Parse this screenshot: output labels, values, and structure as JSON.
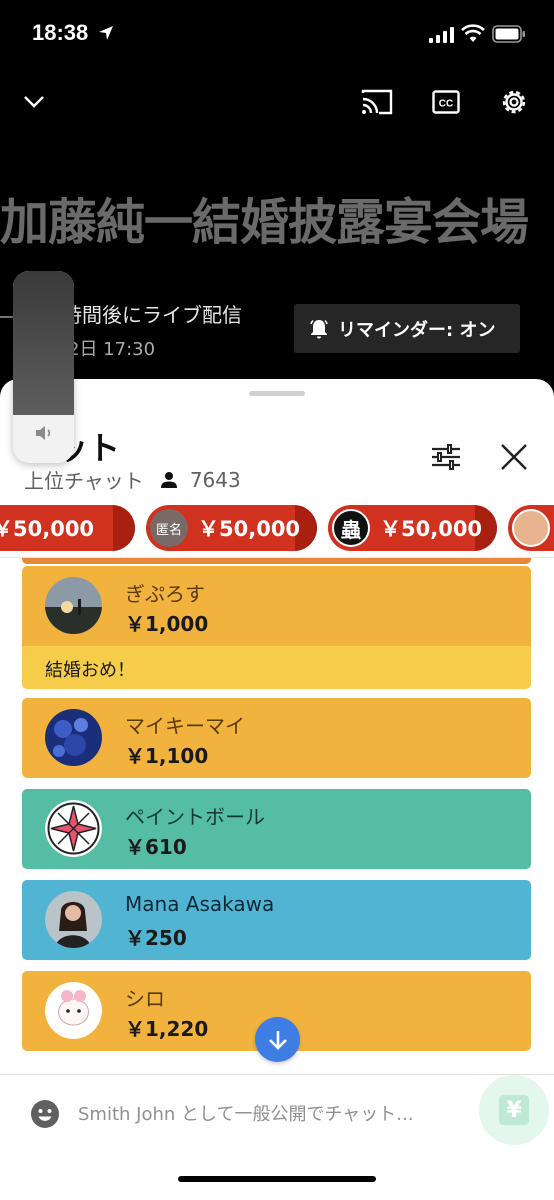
{
  "status_bar": {
    "time": "18:38",
    "icons": [
      "location-arrow-icon",
      "cellular-signal-icon",
      "wifi-icon",
      "battery-icon"
    ]
  },
  "video": {
    "controls": [
      "chevron-down-icon",
      "cast-icon",
      "cc-icon",
      "gear-icon"
    ],
    "title": "加藤純一結婚披露宴会場",
    "live_text": "時間後にライブ配信",
    "date": "2日 17:30",
    "reminder_label": "リマインダー: オン"
  },
  "volume": {
    "level": 0.75
  },
  "chat": {
    "title": "ャット",
    "mode": "上位チャット",
    "viewer_count": "7643",
    "ticker": [
      {
        "amount": "￥50,000",
        "avatar_label": "",
        "avatar_color": "#8a8a8a"
      },
      {
        "amount": "￥50,000",
        "avatar_label": "匿名",
        "avatar_color": "#7a6a66"
      },
      {
        "amount": "￥50,000",
        "avatar_label": "蟲",
        "avatar_color": "#111111"
      },
      {
        "amount": "",
        "avatar_label": "",
        "avatar_color": "#e7b48f"
      }
    ],
    "messages": [
      {
        "name": "ぎぷろす",
        "amount": "￥1,000",
        "message": "結婚おめ！",
        "header_color": "#f2b33e",
        "body_color": "#f5cd4a",
        "avatar": "silhouette"
      },
      {
        "name": "マイキーマイ",
        "amount": "￥1,100",
        "message": "",
        "header_color": "#f2b33e",
        "body_color": "#f2b33e",
        "avatar": "blue-pattern"
      },
      {
        "name": "ペイントボール",
        "amount": "￥610",
        "message": "",
        "header_color": "#56bda5",
        "body_color": "#56bda5",
        "avatar": "star-badge"
      },
      {
        "name": "Mana Asakawa",
        "amount": "￥250",
        "message": "",
        "header_color": "#52b4d3",
        "body_color": "#52b4d3",
        "avatar": "portrait"
      },
      {
        "name": "シロ",
        "amount": "￥1,220",
        "message": "",
        "header_color": "#f2b33e",
        "body_color": "#f2b33e",
        "avatar": "white-cat"
      }
    ],
    "input_placeholder": "Smith John として一般公開でチャット...",
    "superchat_symbol": "¥"
  },
  "colors": {
    "ticker_red": "#d0321f",
    "accent_blue": "#3e7ee4"
  }
}
